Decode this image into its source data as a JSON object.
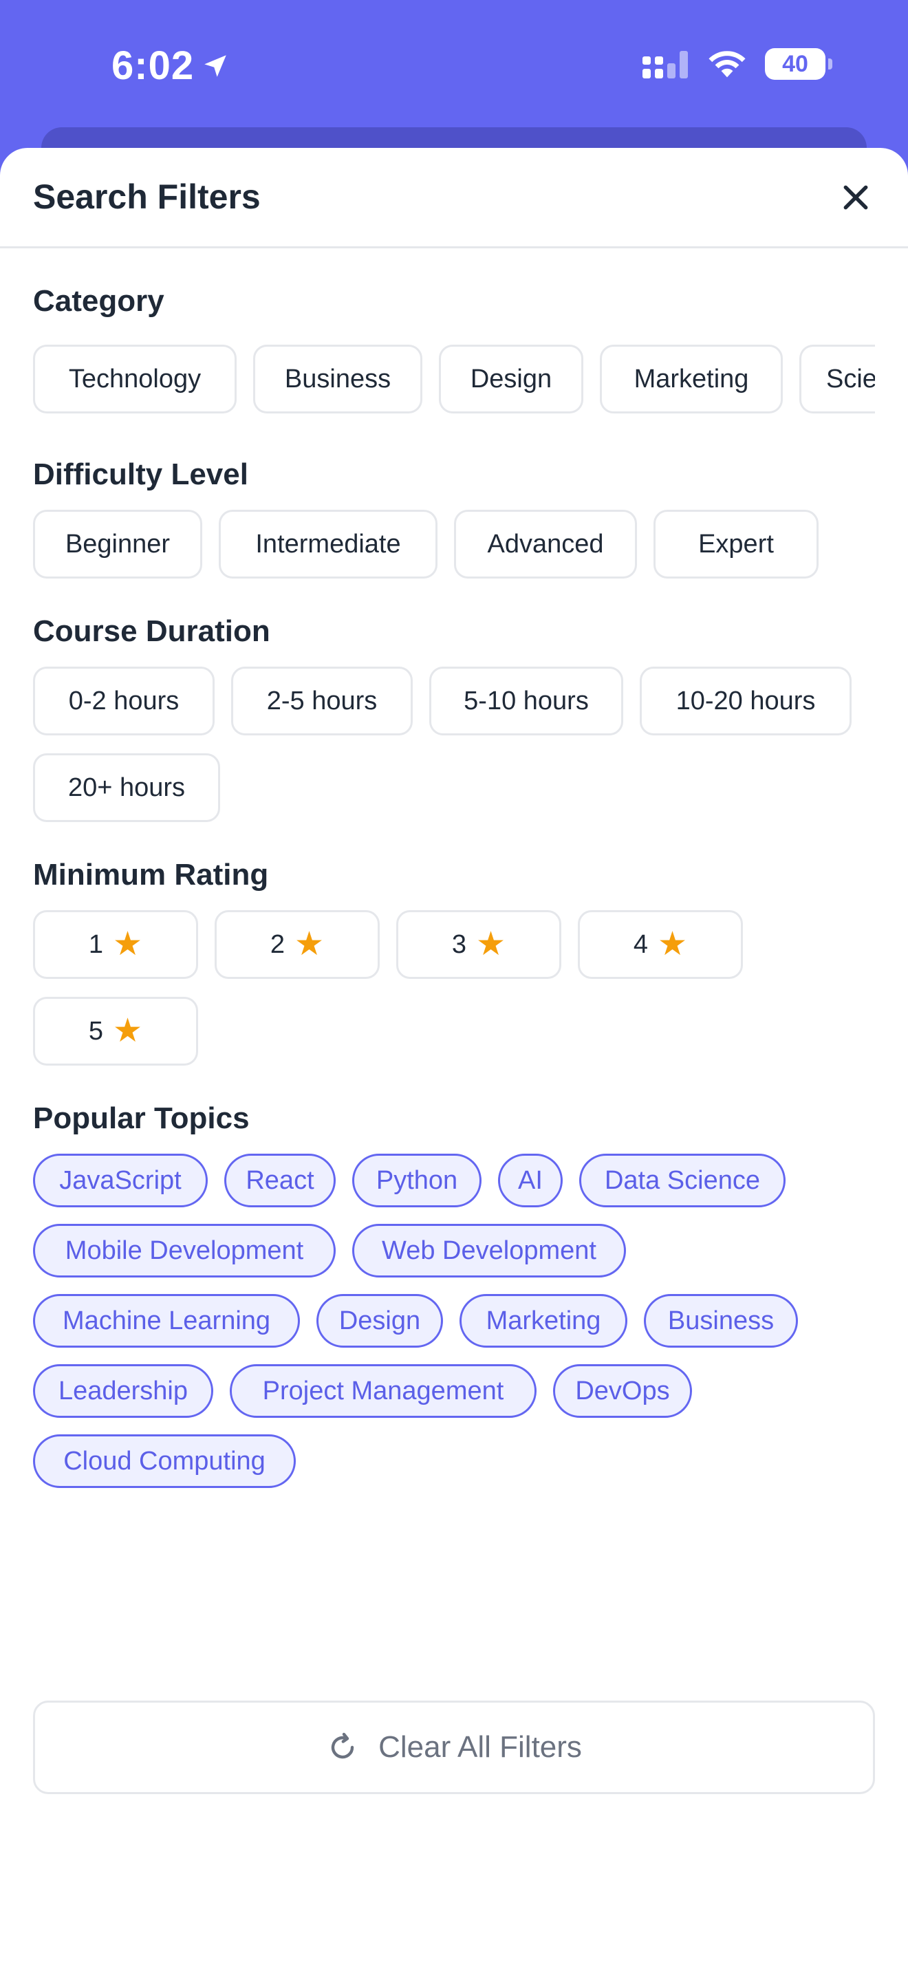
{
  "status_bar": {
    "time": "6:02",
    "battery": "40"
  },
  "sheet": {
    "title": "Search Filters"
  },
  "category": {
    "title": "Category",
    "options": [
      "Technology",
      "Business",
      "Design",
      "Marketing",
      "Scie"
    ]
  },
  "difficulty": {
    "title": "Difficulty Level",
    "options": [
      "Beginner",
      "Intermediate",
      "Advanced",
      "Expert"
    ]
  },
  "duration": {
    "title": "Course Duration",
    "options": [
      "0-2 hours",
      "2-5 hours",
      "5-10 hours",
      "10-20 hours",
      "20+ hours"
    ]
  },
  "rating": {
    "title": "Minimum Rating",
    "options": [
      "1",
      "2",
      "3",
      "4",
      "5"
    ],
    "star_color": "#F59E0B"
  },
  "topics": {
    "title": "Popular Topics",
    "items": [
      "JavaScript",
      "React",
      "Python",
      "AI",
      "Data Science",
      "Mobile Development",
      "Web Development",
      "Machine Learning",
      "Design",
      "Marketing",
      "Business",
      "Leadership",
      "Project Management",
      "DevOps",
      "Cloud Computing"
    ]
  },
  "actions": {
    "clear_label": "Clear All Filters"
  },
  "colors": {
    "accent": "#6366F1",
    "star": "#F59E0B"
  }
}
